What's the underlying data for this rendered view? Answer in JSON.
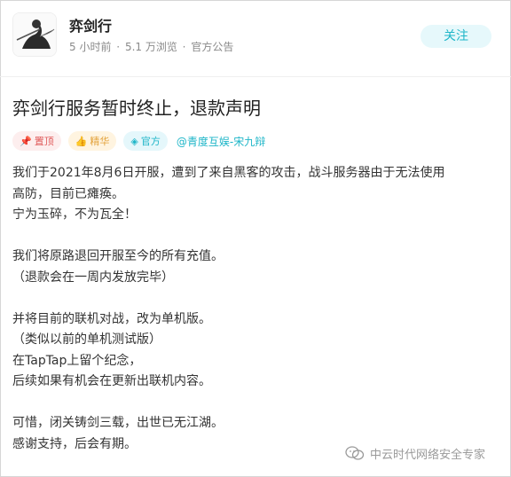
{
  "header": {
    "author": "弈剑行",
    "meta": [
      "5 小时前",
      "·",
      "5.1 万浏览",
      "·",
      "官方公告"
    ],
    "follow_label": "关注"
  },
  "post": {
    "title": "弈剑行服务暂时终止，退款声明",
    "tags": {
      "top": "置顶",
      "essence": "精华",
      "official": "官方",
      "studio": "@青度互娱-宋九辩"
    },
    "lines": [
      "我们于2021年8月6日开服，遭到了来自黑客的攻击，战斗服务器由于无法使用",
      "高防，目前已瘫痪。",
      "宁为玉碎，不为瓦全！",
      "",
      "我们将原路退回开服至今的所有充值。",
      "（退款会在一周内发放完毕）",
      "",
      "并将目前的联机对战，改为单机版。",
      "（类似以前的单机测试版）",
      "在TapTap上留个纪念，",
      "后续如果有机会在更新出联机内容。",
      "",
      "可惜，闭关铸剑三载，出世已无江湖。",
      "感谢支持，后会有期。"
    ]
  },
  "watermark": {
    "text": "中云时代网络安全专家"
  },
  "colors": {
    "accent": "#1fb6c8",
    "top_tag": "#e05a5a",
    "essence_tag": "#e3a23a"
  }
}
